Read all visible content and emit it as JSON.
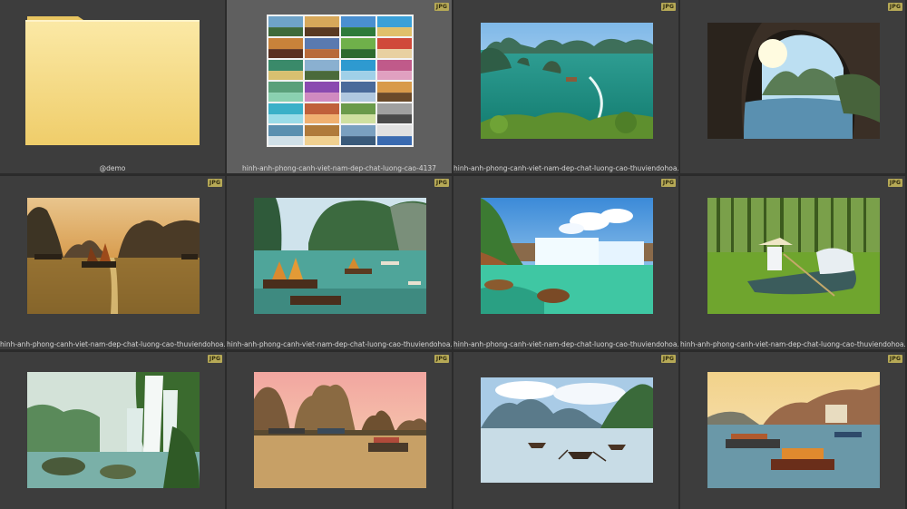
{
  "items": [
    {
      "type": "folder",
      "caption": "@demo",
      "badge": ""
    },
    {
      "type": "collage",
      "caption": "hinh-anh-phong-canh-viet-nam-dep-chat-luong-cao-4137",
      "badge": "JPG"
    },
    {
      "type": "image",
      "scene": "halong-bay",
      "caption": "hinh-anh-phong-canh-viet-nam-dep-chat-luong-cao-thuviendohoa.vn",
      "badge": "JPG"
    },
    {
      "type": "image",
      "scene": "cave",
      "caption": "hinh-anh-phong-canh-viet-nam-dep-chat-luong-cao-thuviendohoa.vn",
      "badge": "JPG"
    },
    {
      "type": "image",
      "scene": "sunset-boats",
      "caption": "hinh-anh-phong-canh-viet-nam-dep-chat-luong-cao-thuviendohoa.vn",
      "badge": "JPG"
    },
    {
      "type": "image",
      "scene": "junk-boats",
      "caption": "hinh-anh-phong-canh-viet-nam-dep-chat-luong-cao-thuviendohoa.vn",
      "badge": "JPG"
    },
    {
      "type": "image",
      "scene": "waterfall-lagoon",
      "caption": "hinh-anh-phong-canh-viet-nam-dep-chat-luong-cao-thuviendohoa.vn",
      "badge": "JPG"
    },
    {
      "type": "image",
      "scene": "rowing-woman",
      "caption": "hinh-anh-phong-canh-viet-nam-dep-chat-luong-cao-thuviendohoa.vn",
      "badge": "JPG"
    },
    {
      "type": "image",
      "scene": "ban-gioc-waterfall",
      "caption": "",
      "badge": "JPG"
    },
    {
      "type": "image",
      "scene": "karst-village",
      "caption": "",
      "badge": "JPG"
    },
    {
      "type": "image",
      "scene": "river-boats",
      "caption": "",
      "badge": "JPG"
    },
    {
      "type": "image",
      "scene": "harbor-boats",
      "caption": "",
      "badge": "JPG"
    }
  ],
  "colors": {
    "background": "#2b2b2b",
    "cell": "#3d3d3d",
    "cell_selected": "#5f5f5f",
    "badge": "#b6a956",
    "folder": "#f4d67c"
  }
}
